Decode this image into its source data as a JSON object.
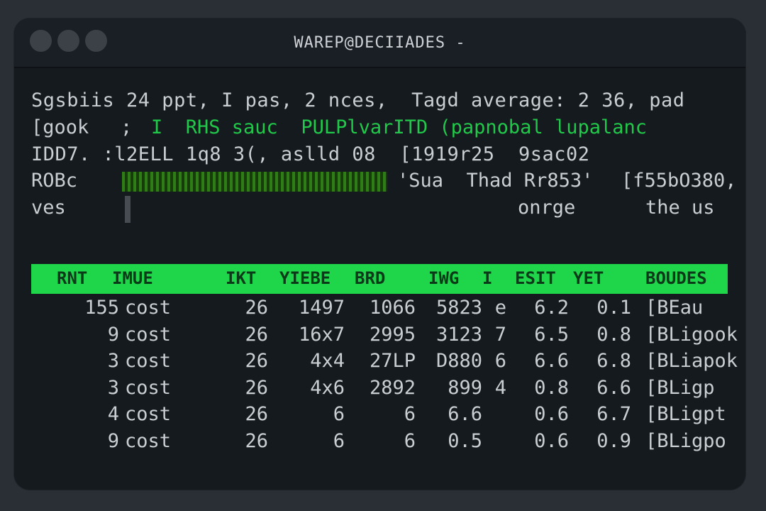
{
  "window": {
    "title": "WAREP@DECIIADES -"
  },
  "summary": {
    "line1": "Sgsbiis 24 ppt, I pas, 2 nces,  Tagd average: 2 36, pad",
    "line2_label": "[gook",
    "line2_sep": ";",
    "line2_green": "I  RHS sauc  PULPlvarITD (papnobal lupalanc",
    "line3": "IDD7. :l2ELL 1q8 3(, aslld 08  [1919r25  9sac02",
    "line4_label": "ROBc",
    "line4_mid": "'Sua  Thad Rr853'",
    "line4_right": "[f55bO380,",
    "line5_label": "ves",
    "line5_mid": "onrge",
    "line5_right": "the us"
  },
  "process_table": {
    "columns": [
      "RNT",
      "IMUE",
      "IKT",
      "YIEBE",
      "BRD",
      "IWG",
      "I",
      "ESIT",
      "YET",
      "BOUDES"
    ],
    "rows": [
      {
        "pid": "155",
        "name": "cost",
        "c3": "26",
        "c4": "1497",
        "c5": "1066",
        "c6": "5823",
        "c7": "e",
        "c8": "6.2",
        "c9": "0.1",
        "cmd": "[BEau"
      },
      {
        "pid": "9",
        "name": "cost",
        "c3": "26",
        "c4": "16x7",
        "c5": "2995",
        "c6": "3123",
        "c7": "7",
        "c8": "6.5",
        "c9": "0.8",
        "cmd": "[BLigook"
      },
      {
        "pid": "3",
        "name": "cost",
        "c3": "26",
        "c4": "4x4",
        "c5": "27LP",
        "c6": "D880",
        "c7": "6",
        "c8": "6.6",
        "c9": "6.8",
        "cmd": "[BLiapok"
      },
      {
        "pid": "3",
        "name": "cost",
        "c3": "26",
        "c4": "4x6",
        "c5": "2892",
        "c6": "899",
        "c7": "4",
        "c8": "0.8",
        "c9": "6.6",
        "cmd": "[BLigp"
      },
      {
        "pid": "4",
        "name": "cost",
        "c3": "26",
        "c4": "6",
        "c5": "6",
        "c6": "6.6",
        "c7": "",
        "c8": "0.6",
        "c9": "6.7",
        "cmd": "[BLigpt"
      },
      {
        "pid": "9",
        "name": "cost",
        "c3": "26",
        "c4": "6",
        "c5": "6",
        "c6": "0.5",
        "c7": "",
        "c8": "0.6",
        "c9": "0.9",
        "cmd": "[BLigpo"
      }
    ]
  },
  "colors": {
    "accent_green": "#1fd54a",
    "background": "#151a1f",
    "text": "#c9ced3"
  }
}
